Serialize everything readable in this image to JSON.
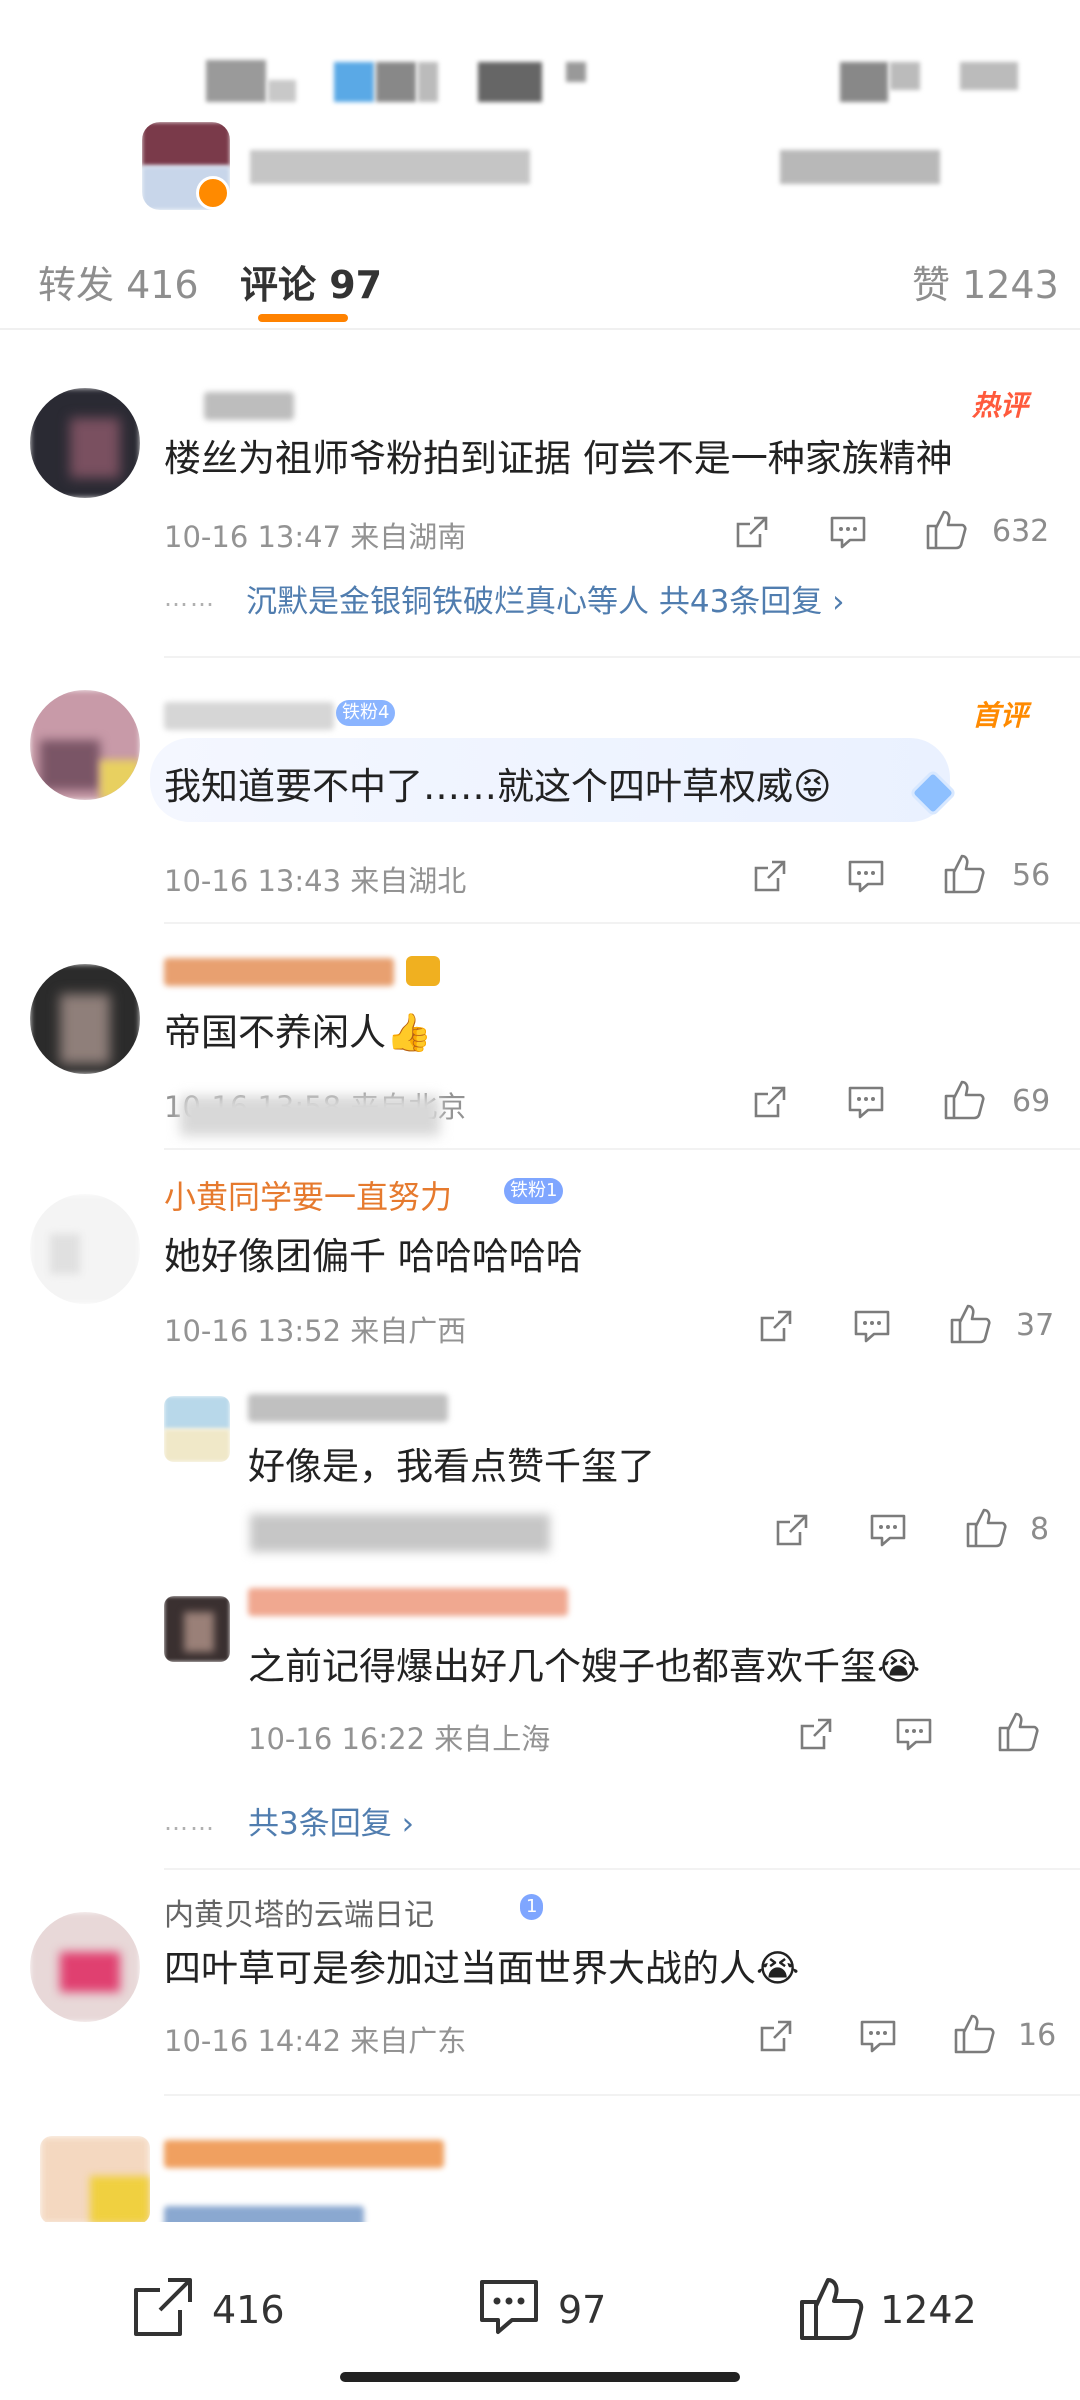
{
  "tabs": {
    "repost": "转发 416",
    "comments": "评论 97",
    "likes": "赞 1243"
  },
  "comments": [
    {
      "badge": "热评",
      "text": "楼丝为祖师爷粉拍到证据 何尝不是一种家族精神",
      "meta": "10-16 13:47  来自湖南",
      "likes": "632",
      "replies_link": "沉默是金银铜铁破烂真心等人  共43条回复 ›"
    },
    {
      "badge": "首评",
      "fan_badge": "铁粉4",
      "text": "我知道要不中了……就这个四叶草权威😝",
      "meta": "10-16 13:43  来自湖北",
      "likes": "56"
    },
    {
      "text": "帝国不养闲人👍",
      "meta": "10-16 13:58  来自北京",
      "likes": "69"
    },
    {
      "name": "小黄同学要一直努力",
      "fan_badge": "铁粉1",
      "text": "她好像团偏千 哈哈哈哈哈",
      "meta": "10-16 13:52  来自广西",
      "likes": "37",
      "replies": [
        {
          "text": "好像是，我看点赞千玺了",
          "likes": "8"
        },
        {
          "text": "之前记得爆出好几个嫂子也都喜欢千玺😭",
          "meta": "10-16 16:22  来自上海",
          "likes": ""
        }
      ],
      "replies_link": "共3条回复 ›"
    },
    {
      "name": "内黄贝塔的云端日记",
      "fan_badge": "1",
      "text": "四叶草可是参加过当面世界大战的人😭",
      "meta": "10-16 14:42  来自广东",
      "likes": "16"
    }
  ],
  "bottom_bar": {
    "repost": "416",
    "comment": "97",
    "like": "1242"
  },
  "colors": {
    "accent": "#ff8200",
    "link": "#507daf",
    "hot": "#ff5a3c"
  },
  "icons": [
    "share-icon",
    "comment-icon",
    "like-icon",
    "chevron-right-icon"
  ]
}
